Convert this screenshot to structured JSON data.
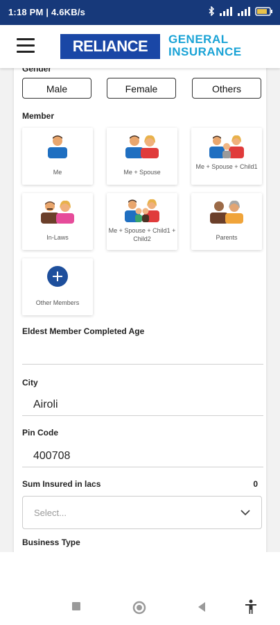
{
  "status": {
    "time": "1:18 PM | 4.6KB/s",
    "battery": "61"
  },
  "header": {
    "logo_main": "RELIANCE",
    "logo_sub_line1": "GENERAL",
    "logo_sub_line2": "INSURANCE"
  },
  "form": {
    "gender_label": "Gender",
    "gender_options": [
      "Male",
      "Female",
      "Others"
    ],
    "member_label": "Member",
    "members": [
      {
        "label": "Me",
        "icon": "single-person-icon"
      },
      {
        "label": "Me + Spouse",
        "icon": "couple-icon"
      },
      {
        "label": "Me + Spouse + Child1",
        "icon": "family-one-child-icon"
      },
      {
        "label": "In-Laws",
        "icon": "in-laws-icon"
      },
      {
        "label": "Me + Spouse + Child1 + Child2",
        "icon": "family-two-children-icon"
      },
      {
        "label": "Parents",
        "icon": "parents-icon"
      },
      {
        "label": "Other Members",
        "icon": "add-member-icon"
      }
    ],
    "eldest_label": "Eldest Member Completed Age",
    "eldest_value": "",
    "city_label": "City",
    "city_value": "Airoli",
    "pin_label": "Pin Code",
    "pin_value": "400708",
    "sum_label": "Sum Insured in lacs",
    "sum_value": "0",
    "sum_placeholder": "Select...",
    "business_label": "Business Type"
  }
}
